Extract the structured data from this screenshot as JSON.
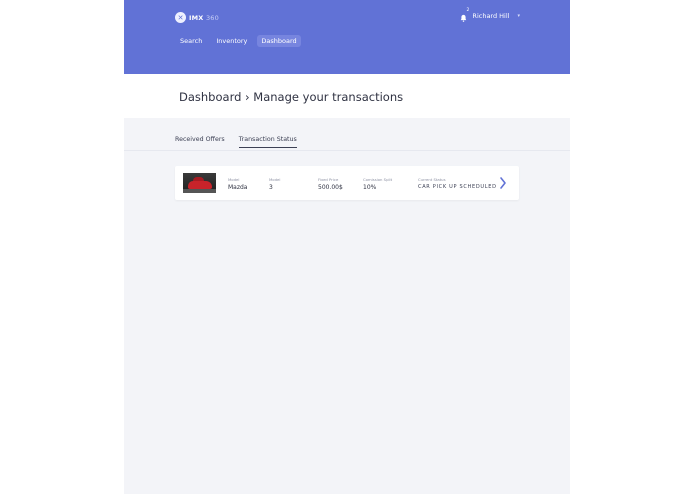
{
  "header": {
    "logo_text": "IMX",
    "logo_suffix": "360",
    "notification_count": "2",
    "user_name": "Richard Hill"
  },
  "nav": {
    "items": [
      {
        "label": "Search"
      },
      {
        "label": "Inventory"
      },
      {
        "label": "Dashboard"
      }
    ]
  },
  "page": {
    "title": "Dashboard › Manage your transactions"
  },
  "tabs": [
    {
      "label": "Received Offers"
    },
    {
      "label": "Transaction Status"
    }
  ],
  "transaction": {
    "make_label": "Model",
    "make_value": "Mazda",
    "model_label": "Model",
    "model_value": "3",
    "price_label": "Fixed Price",
    "price_value": "500.00$",
    "split_label": "Comission Split",
    "split_value": "10%",
    "status_label": "Current Status",
    "status_value": "CAR PICK UP SCHEDULED"
  },
  "colors": {
    "accent": "#6172d6",
    "background": "#f3f4f8"
  }
}
